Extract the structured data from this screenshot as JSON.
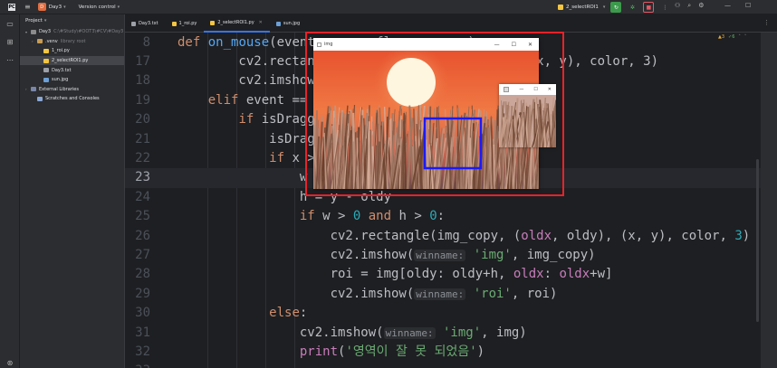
{
  "titlebar": {
    "app_logo": "PC",
    "project_badge": "D",
    "project_name": "Day3",
    "vcs_label": "Version control",
    "run_config": "2_selectROI1",
    "icons": [
      "hamburger-icon",
      "run-icon",
      "debug-icon",
      "stop-icon",
      "more-icon",
      "add-user-icon",
      "search-icon",
      "settings-icon"
    ]
  },
  "project_panel": {
    "title": "Project",
    "tree": [
      {
        "label": "Day3",
        "muted": "C:\\#Study\\#OOT3\\#CV\\#Day3",
        "icon": "folder",
        "arrow": "▾",
        "indent": 0
      },
      {
        "label": ".venv",
        "muted": "library root",
        "icon": "venv",
        "arrow": "›",
        "indent": 1
      },
      {
        "label": "1_roi.py",
        "muted": "",
        "icon": "py",
        "arrow": "",
        "indent": 2
      },
      {
        "label": "2_selectROI1.py",
        "muted": "",
        "icon": "py",
        "arrow": "",
        "indent": 2,
        "selected": true
      },
      {
        "label": "Day3.txt",
        "muted": "",
        "icon": "txt",
        "arrow": "",
        "indent": 2
      },
      {
        "label": "sun.jpg",
        "muted": "",
        "icon": "jpg",
        "arrow": "",
        "indent": 2
      },
      {
        "label": "External Libraries",
        "muted": "",
        "icon": "lib",
        "arrow": "›",
        "indent": 0
      },
      {
        "label": "Scratches and Consoles",
        "muted": "",
        "icon": "scratch",
        "arrow": "",
        "indent": 1
      }
    ]
  },
  "tabs": [
    {
      "label": "Day3.txt",
      "icon": "txt",
      "active": false
    },
    {
      "label": "1_roi.py",
      "icon": "py",
      "active": false
    },
    {
      "label": "2_selectROI1.py",
      "icon": "py",
      "active": true
    },
    {
      "label": "sun.jpg",
      "icon": "jpg",
      "active": false
    }
  ],
  "editor": {
    "status_warnings": "▲3",
    "status_ok": "✓6",
    "current_line": 23,
    "lines": [
      {
        "n": 8,
        "html": "<span class=\"kw\">def</span> <span class=\"fn\">on_mouse</span>(event, x, y, flags, param):"
      },
      {
        "n": 17,
        "html": "        cv2.rectangle(img_copy, (oldx, oldy), (x, y), color, 3)"
      },
      {
        "n": 18,
        "html": "        cv2.imshow(<span class=\"hint\">winname:</span> <span class=\"str\">'img'</span>, img_copy)"
      },
      {
        "n": 19,
        "html": "    <span class=\"kw\">elif</span> event == cv2.EVENT_LBUTTONUP:"
      },
      {
        "n": 20,
        "html": "        <span class=\"kw\">if</span> isDragging:"
      },
      {
        "n": 21,
        "html": "            isDragging = <span class=\"kw\">False</span>"
      },
      {
        "n": 22,
        "html": "            <span class=\"kw\">if</span> x > oldx <span class=\"kw\">and</span> y > oldy:"
      },
      {
        "n": 23,
        "html": "                w = x - oldx"
      },
      {
        "n": 24,
        "html": "                h = y - oldy"
      },
      {
        "n": 25,
        "html": "                <span class=\"kw\">if</span> w > <span class=\"num\">0</span> <span class=\"kw\">and</span> h > <span class=\"num\">0</span>:"
      },
      {
        "n": 26,
        "html": "                    cv2.rectangle(img_copy, (<span class=\"fnc\">oldx</span>, oldy), (x, y), color, <span class=\"num\">3</span>)"
      },
      {
        "n": 27,
        "html": "                    cv2.imshow(<span class=\"hint\">winname:</span> <span class=\"str\">'img'</span>, img_copy)"
      },
      {
        "n": 28,
        "html": "                    roi = img[oldy: oldy+h, <span class=\"fnc\">oldx</span>: <span class=\"fnc\">oldx</span>+w]"
      },
      {
        "n": 29,
        "html": "                    cv2.imshow(<span class=\"hint\">winname:</span> <span class=\"str\">'roi'</span>, roi)"
      },
      {
        "n": 30,
        "html": "            <span class=\"kw\">else</span>:"
      },
      {
        "n": 31,
        "html": "                cv2.imshow(<span class=\"hint\">winname:</span> <span class=\"str\">'img'</span>, img)"
      },
      {
        "n": 32,
        "html": "                <span class=\"fnc\">print</span>(<span class=\"str\">'영역이 잘 못 되었음'</span>)"
      },
      {
        "n": 33,
        "html": ""
      }
    ]
  },
  "img_window": {
    "title": "img",
    "controls": [
      "—",
      "☐",
      "✕"
    ]
  },
  "roi_window": {
    "controls": [
      "—",
      "☐",
      "✕"
    ]
  }
}
